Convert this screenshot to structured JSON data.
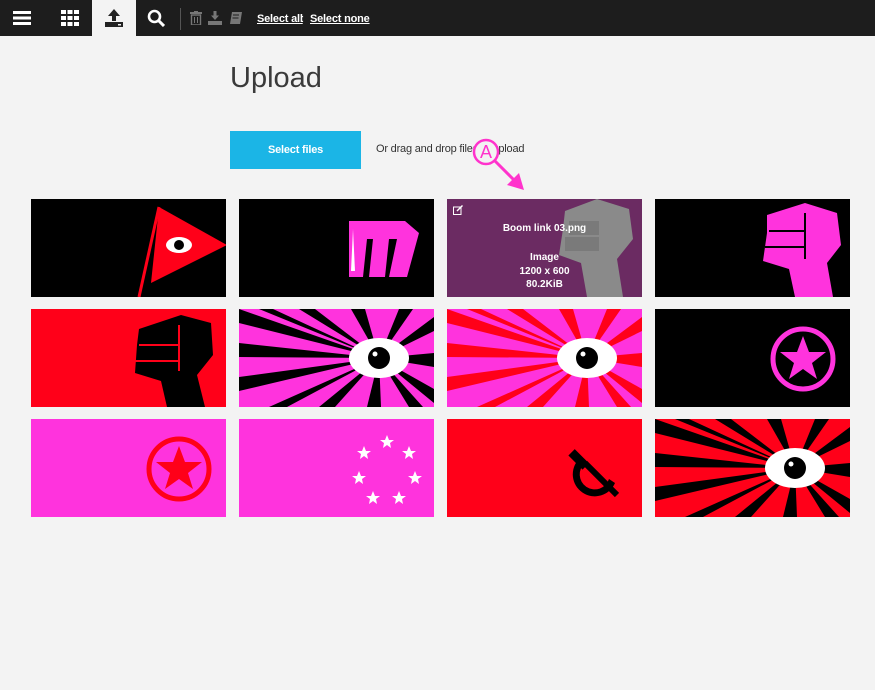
{
  "toolbar": {
    "menu_icon": "hamburger-icon",
    "grid_icon": "grid-icon",
    "upload_icon": "upload-icon",
    "search_icon": "search-icon",
    "delete_icon": "trash-icon",
    "download_icon": "download-icon",
    "archive_icon": "book-icon",
    "select_all": "Select all",
    "separator": ":",
    "select_none": "Select none"
  },
  "page": {
    "title": "Upload",
    "select_files": "Select files",
    "drag_text": "Or drag and drop files to upload"
  },
  "annotation": {
    "letter": "A",
    "color": "#ff33cc"
  },
  "hovered_tile": {
    "name": "Boom link 03.png",
    "type": "Image",
    "dimensions": "1200 x 600",
    "size": "80.2KiB"
  },
  "colors": {
    "pink": "#ff33dd",
    "red": "#ff0019",
    "black": "#000000",
    "blue": "#1bb5e6",
    "overlay": "#6b2b62"
  }
}
